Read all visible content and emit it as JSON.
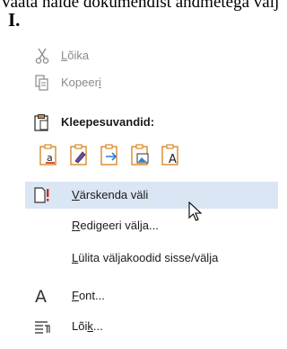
{
  "document": {
    "top_line": "Vaata näide dokumendist andmetega välja nr X. „",
    "heading": "I."
  },
  "context_menu": {
    "items": [
      {
        "id": "cut",
        "label": "Lõika",
        "underline": "L",
        "disabled": true,
        "icon": "scissors-icon"
      },
      {
        "id": "copy",
        "label": "Kopeeri",
        "underline": "i",
        "disabled": true,
        "icon": "copy-icon"
      },
      {
        "id": "paste_options",
        "label": "Kleepesuvandid:",
        "icon": "clipboard-icon"
      },
      {
        "id": "update_field",
        "label": "Värskenda väli",
        "underline": "V",
        "hovered": true,
        "icon": "update-field-icon"
      },
      {
        "id": "edit_field",
        "label": "Redigeeri välja...",
        "underline": "R"
      },
      {
        "id": "toggle_field_codes",
        "label": "Lülita väljakoodid sisse/välja",
        "underline": "L"
      },
      {
        "id": "font",
        "label": "Font...",
        "underline": "F",
        "icon": "font-icon"
      },
      {
        "id": "paragraph",
        "label": "Lõik...",
        "underline": "k",
        "icon": "paragraph-icon"
      }
    ],
    "paste_buttons": [
      {
        "name": "paste-keep-source-formatting-icon"
      },
      {
        "name": "paste-merge-formatting-icon"
      },
      {
        "name": "paste-link-icon"
      },
      {
        "name": "paste-picture-icon"
      },
      {
        "name": "paste-keep-text-only-icon"
      }
    ]
  },
  "colors": {
    "hover_bg": "#dbe6f4",
    "accent_orange": "#d88a2a",
    "accent_red": "#c42b1c",
    "disabled_text": "#8a8a8a"
  }
}
